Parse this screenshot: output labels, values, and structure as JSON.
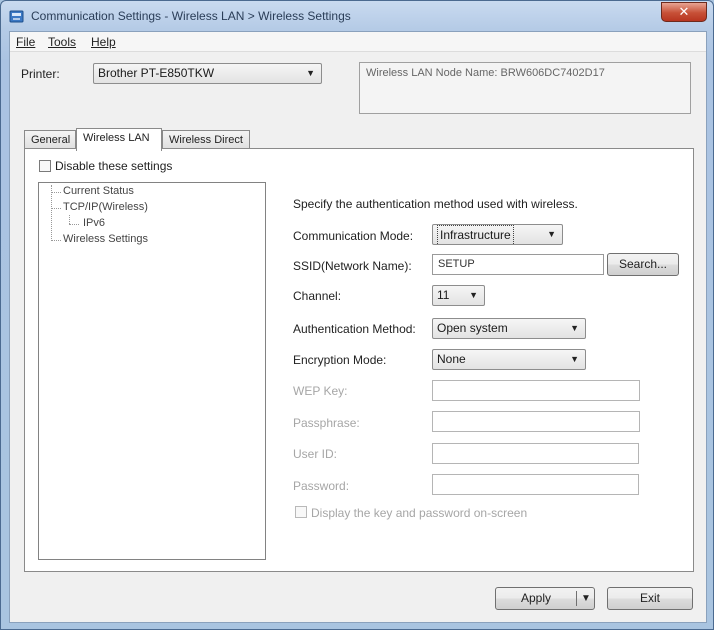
{
  "window": {
    "title": "Communication Settings - Wireless LAN > Wireless Settings",
    "close_glyph": "✕"
  },
  "menu": [
    "File",
    "Tools",
    "Help"
  ],
  "printer": {
    "label": "Printer:",
    "value": "Brother PT-E850TKW"
  },
  "node_name": "Wireless LAN Node Name: BRW606DC7402D17",
  "tabs": [
    "General",
    "Wireless LAN",
    "Wireless Direct"
  ],
  "active_tab": 1,
  "disable_settings": "Disable these settings",
  "tree": {
    "items": [
      "Current Status",
      "TCP/IP(Wireless)",
      "IPv6",
      "Wireless Settings"
    ]
  },
  "settings": {
    "description": "Specify the authentication method used with wireless.",
    "comm_mode_label": "Communication Mode:",
    "comm_mode_value": "Infrastructure",
    "ssid_label": "SSID(Network Name):",
    "ssid_value": "SETUP",
    "search_button": "Search...",
    "channel_label": "Channel:",
    "channel_value": "11",
    "auth_label": "Authentication Method:",
    "auth_value": "Open system",
    "enc_label": "Encryption Mode:",
    "enc_value": "None",
    "wep_label": "WEP Key:",
    "passphrase_label": "Passphrase:",
    "userid_label": "User ID:",
    "password_label": "Password:",
    "display_key_label": "Display the key and password on-screen"
  },
  "buttons": {
    "apply": "Apply",
    "exit": "Exit",
    "dropdown_glyph": "▼"
  },
  "colors": {
    "titlebar": "#b5cbe6",
    "close_button": "#c75037",
    "panel_bg": "#ffffff",
    "dialog_bg": "#f0f0f0"
  }
}
